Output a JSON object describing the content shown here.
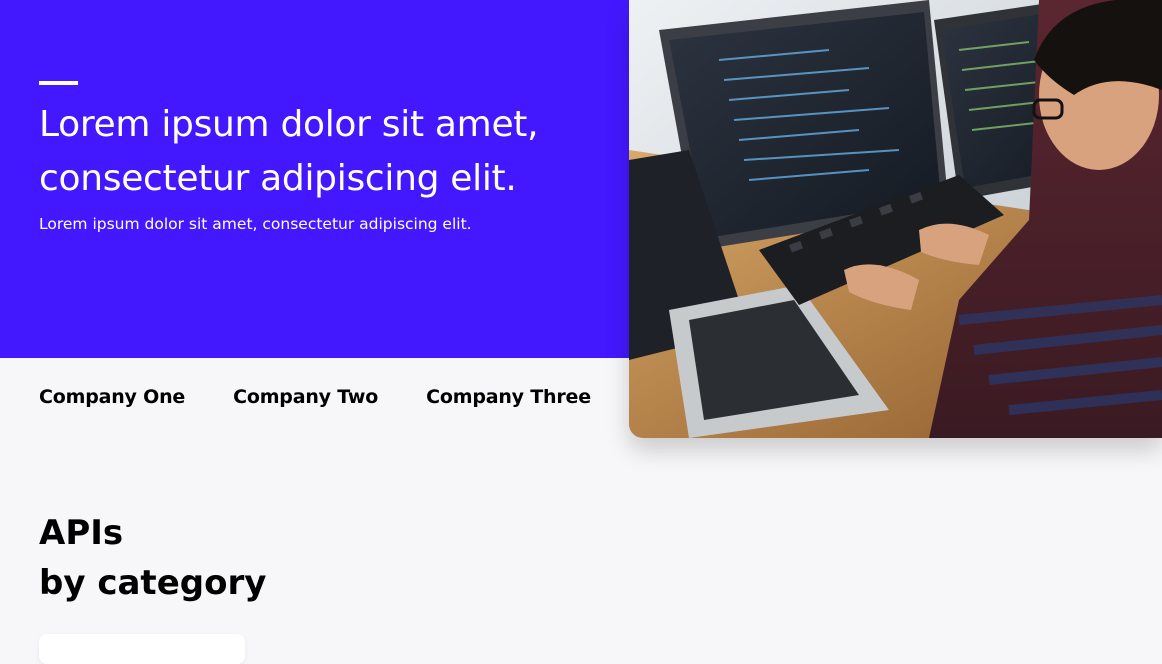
{
  "hero": {
    "title_line1": "Lorem ipsum dolor sit amet,",
    "title_line2": "consectetur adipiscing elit.",
    "subtitle": "Lorem ipsum dolor sit amet, consectetur adipiscing elit.",
    "background_color": "#4318ff"
  },
  "companies": [
    "Company One",
    "Company Two",
    "Company Three"
  ],
  "hero_image": {
    "icon": "developer-at-computers-photo"
  },
  "apis_section": {
    "title_line1": "APIs",
    "title_line2": "by category"
  }
}
